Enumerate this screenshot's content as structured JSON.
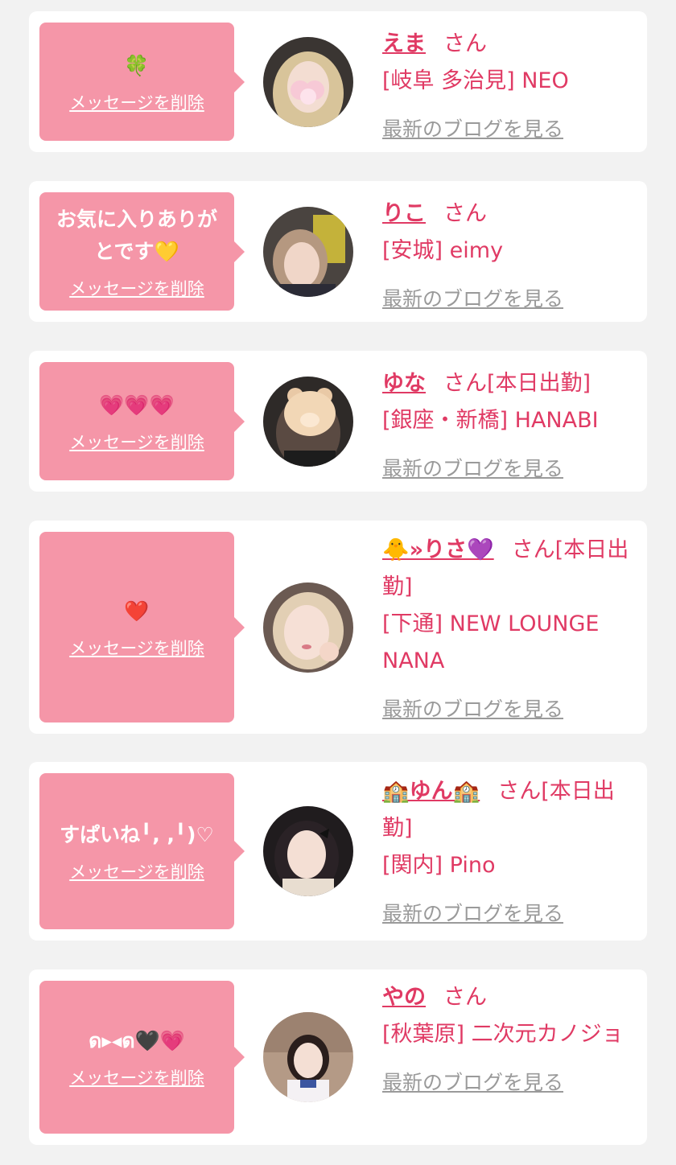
{
  "colors": {
    "background": "#f2f2f2",
    "card": "#ffffff",
    "bubble": "#f596a8",
    "accent": "#e03a64",
    "link_gray": "#9a9a9a"
  },
  "delete_label": "メッセージを削除",
  "blog_label": "最新のブログを見る",
  "cards": [
    {
      "message": "🍀",
      "name": "えま",
      "suffix": "さん",
      "shop": "[岐阜 多治見] NEO"
    },
    {
      "message": "お気に入りありがとです💛",
      "name": "りこ",
      "suffix": "さん",
      "shop": "[安城] eimy"
    },
    {
      "message": "💗💗💗",
      "name": "ゆな",
      "suffix": "さん[本日出勤]",
      "shop": "[銀座・新橋] HANABI"
    },
    {
      "message": "❤️",
      "name": "🐥»りさ💜",
      "suffix": "さん[本日出勤]",
      "shop": "[下通] NEW LOUNGE NANA"
    },
    {
      "message": "すぱいね╹, ,╹)♡",
      "name": "🏫ゆん🏫",
      "suffix": "さん[本日出勤]",
      "shop": "[関内] Pino"
    },
    {
      "message": "ด▸◂ด🖤💗",
      "name": "やの",
      "suffix": "さん",
      "shop": "[秋葉原] 二次元カノジョ"
    }
  ]
}
